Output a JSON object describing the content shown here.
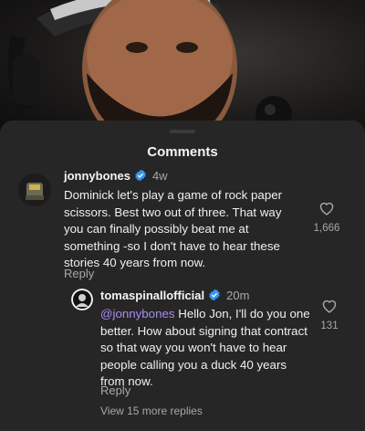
{
  "sheet": {
    "title": "Comments"
  },
  "comments": [
    {
      "username": "jonnybones",
      "time": "4w",
      "text": "Dominick let's play a game of rock paper scissors. Best two out of three. That way you can finally possibly beat me at something -so I don't have to hear these stories 40 years from now.",
      "likes": "1,666",
      "reply_label": "Reply"
    },
    {
      "username": "tomaspinallofficial",
      "time": "20m",
      "mention": "@jonnybones",
      "text": " Hello Jon, I'll do you one better. How about signing that contract so that way you won't have to hear people calling you a duck 40 years from now.",
      "likes": "131",
      "reply_label": "Reply"
    }
  ],
  "view_more": "View 15 more replies",
  "colors": {
    "sheet_bg": "#262626",
    "verified": "#3797f0",
    "mention": "#a98cf5",
    "muted": "#a8a8a8"
  },
  "icons": [
    "verified-badge-icon",
    "heart-outline-icon"
  ]
}
